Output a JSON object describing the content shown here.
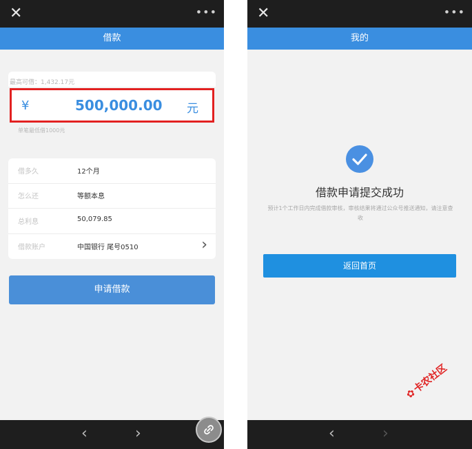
{
  "left_screen": {
    "close_icon": "✕",
    "more_icon": "•••",
    "title": "借款",
    "max_amount_label": "最高可借：1,432.17元",
    "currency_symbol": "¥",
    "amount": "500,000.00",
    "amount_unit": "元",
    "min_amount_note": "单笔最低借1000元",
    "details": [
      {
        "label": "借多久",
        "value": "12个月"
      },
      {
        "label": "怎么还",
        "value": "等额本息"
      },
      {
        "label": "总利息",
        "value": "50,079.85"
      },
      {
        "label": "借款账户",
        "value": "中国银行 尾号0510"
      }
    ],
    "apply_button": "申请借款",
    "nav_back": "‹",
    "nav_forward": "›"
  },
  "right_screen": {
    "close_icon": "✕",
    "more_icon": "•••",
    "title": "我的",
    "success_title": "借款申请提交成功",
    "success_desc": "预计1个工作日内完成借款审核，审核结果将通过公众号推送通知，请注意查收",
    "home_button": "返回首页",
    "nav_back": "‹",
    "nav_forward": "›"
  },
  "watermark": "卡农社区",
  "colors": {
    "header_blue": "#3a8ee0",
    "button_blue": "#4a8fd8",
    "highlight_red": "#e22020",
    "dark_bar": "#1e1e1e"
  }
}
